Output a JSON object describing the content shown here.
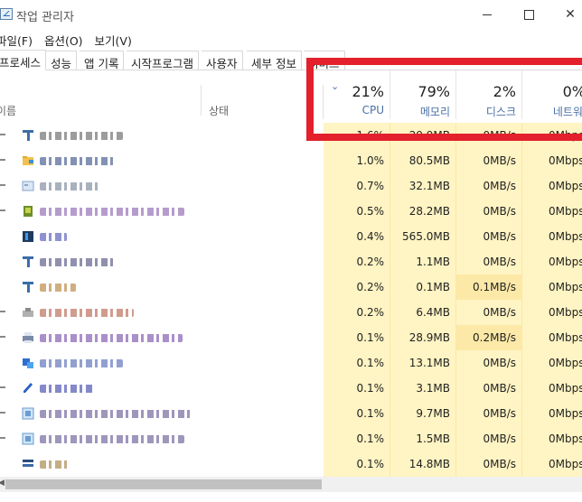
{
  "window": {
    "title": "작업 관리자"
  },
  "menu": [
    "파일(F)",
    "옵션(O)",
    "보기(V)"
  ],
  "tabs": [
    "프로세스",
    "성능",
    "앱 기록",
    "시작프로그램",
    "사용자",
    "세부 정보",
    "서비스"
  ],
  "columns": {
    "name_label": "이름",
    "status_label": "상태",
    "metrics": [
      {
        "percent": "21%",
        "label": "CPU"
      },
      {
        "percent": "79%",
        "label": "메모리"
      },
      {
        "percent": "2%",
        "label": "디스크"
      },
      {
        "percent": "0%",
        "label": "네트워크"
      }
    ]
  },
  "colors": {
    "highlight": "#e3202b",
    "cell_bg": "#fff4c3",
    "cell_hot": "#fde9a7",
    "header_label": "#4a6fa5"
  },
  "rows": [
    {
      "cpu": "1.6%",
      "mem": "29.9MB",
      "disk": "0MB/s",
      "net": "0Mbps",
      "icon": "generic-app-icon",
      "blur": [
        "#8a8a8a",
        92
      ]
    },
    {
      "cpu": "1.0%",
      "mem": "80.5MB",
      "disk": "0MB/s",
      "net": "0Mbps",
      "icon": "folder-icon",
      "blur": [
        "#6d7ea6",
        82
      ]
    },
    {
      "cpu": "0.7%",
      "mem": "32.1MB",
      "disk": "0MB/s",
      "net": "0Mbps",
      "icon": "window-icon",
      "blur": [
        "#9aa3b4",
        68
      ]
    },
    {
      "cpu": "0.5%",
      "mem": "28.2MB",
      "disk": "0MB/s",
      "net": "0Mbps",
      "icon": "green-app-icon",
      "blur": [
        "#a98bc4",
        160
      ]
    },
    {
      "cpu": "0.4%",
      "mem": "565.0MB",
      "disk": "0MB/s",
      "net": "0Mbps",
      "icon": "dark-app-icon",
      "blur": [
        "#7a7fc8",
        30
      ]
    },
    {
      "cpu": "0.2%",
      "mem": "1.1MB",
      "disk": "0MB/s",
      "net": "0Mbps",
      "icon": "generic-app-icon",
      "blur": [
        "#7d7da0",
        82
      ]
    },
    {
      "cpu": "0.2%",
      "mem": "0.1MB",
      "disk": "0.1MB/s",
      "net": "0Mbps",
      "icon": "generic-app-icon",
      "blur": [
        "#c9a06a",
        40
      ],
      "hot_disk": true
    },
    {
      "cpu": "0.2%",
      "mem": "6.4MB",
      "disk": "0MB/s",
      "net": "0Mbps",
      "icon": "gear-app-icon",
      "blur": [
        "#c88b7a",
        104
      ]
    },
    {
      "cpu": "0.1%",
      "mem": "28.9MB",
      "disk": "0.2MB/s",
      "net": "0Mbps",
      "icon": "printer-icon",
      "blur": [
        "#9b7cc0",
        158
      ],
      "hot_disk": true
    },
    {
      "cpu": "0.1%",
      "mem": "13.1MB",
      "disk": "0MB/s",
      "net": "0Mbps",
      "icon": "blue-app-icon",
      "blur": [
        "#7f8fc8",
        92
      ]
    },
    {
      "cpu": "0.1%",
      "mem": "3.1MB",
      "disk": "0MB/s",
      "net": "0Mbps",
      "icon": "pen-icon",
      "blur": [
        "#6f74c0",
        60
      ]
    },
    {
      "cpu": "0.1%",
      "mem": "9.7MB",
      "disk": "0MB/s",
      "net": "0Mbps",
      "icon": "system-icon",
      "blur": [
        "#8e84b0",
        170
      ]
    },
    {
      "cpu": "0.1%",
      "mem": "1.5MB",
      "disk": "0MB/s",
      "net": "0Mbps",
      "icon": "system-icon",
      "blur": [
        "#8e84b0",
        160
      ]
    },
    {
      "cpu": "0.1%",
      "mem": "14.8MB",
      "disk": "0MB/s",
      "net": "0Mbps",
      "icon": "service-icon",
      "blur": [
        "#b8a070",
        34
      ]
    }
  ]
}
